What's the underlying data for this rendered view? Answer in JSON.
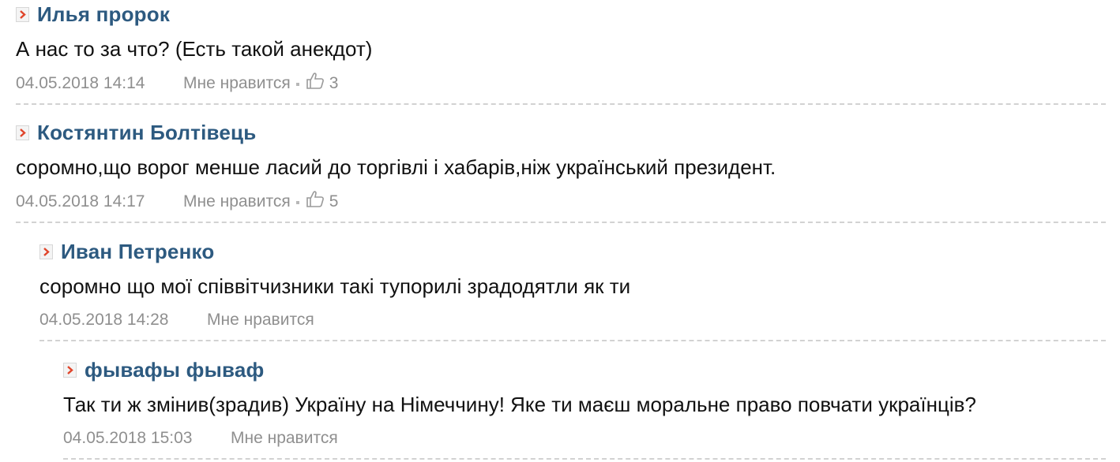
{
  "comments": [
    {
      "author": "Илья пророк",
      "text": "А нас то за что? (Есть такой анекдот)",
      "date": "04.05.2018 14:14",
      "like_label": "Мне нравится",
      "like_count": "3"
    },
    {
      "author": "Костянтин Болтівець",
      "text": "соромно,що ворог менше ласий до торгівлі і хабарів,ніж український президент.",
      "date": "04.05.2018 14:17",
      "like_label": "Мне нравится",
      "like_count": "5"
    },
    {
      "author": "Иван Петренко",
      "text": "соромно що мої співвітчизники такі тупорилі зрадодятли як ти",
      "date": "04.05.2018 14:28",
      "like_label": "Мне нравится"
    },
    {
      "author": "фывафы фываф",
      "text": "Так ти ж змінив(зрадив) Україну на Німеччину! Яке ти маєш моральне право повчати українців?",
      "date": "04.05.2018 15:03",
      "like_label": "Мне нравится"
    }
  ],
  "icons": {
    "author_marker": "chevron-right-icon",
    "like": "thumbs-up-icon"
  },
  "colors": {
    "author": "#2d5a80",
    "marker_arrow": "#e0452b",
    "meta": "#8f8f8f",
    "divider": "#d2d2d2"
  }
}
